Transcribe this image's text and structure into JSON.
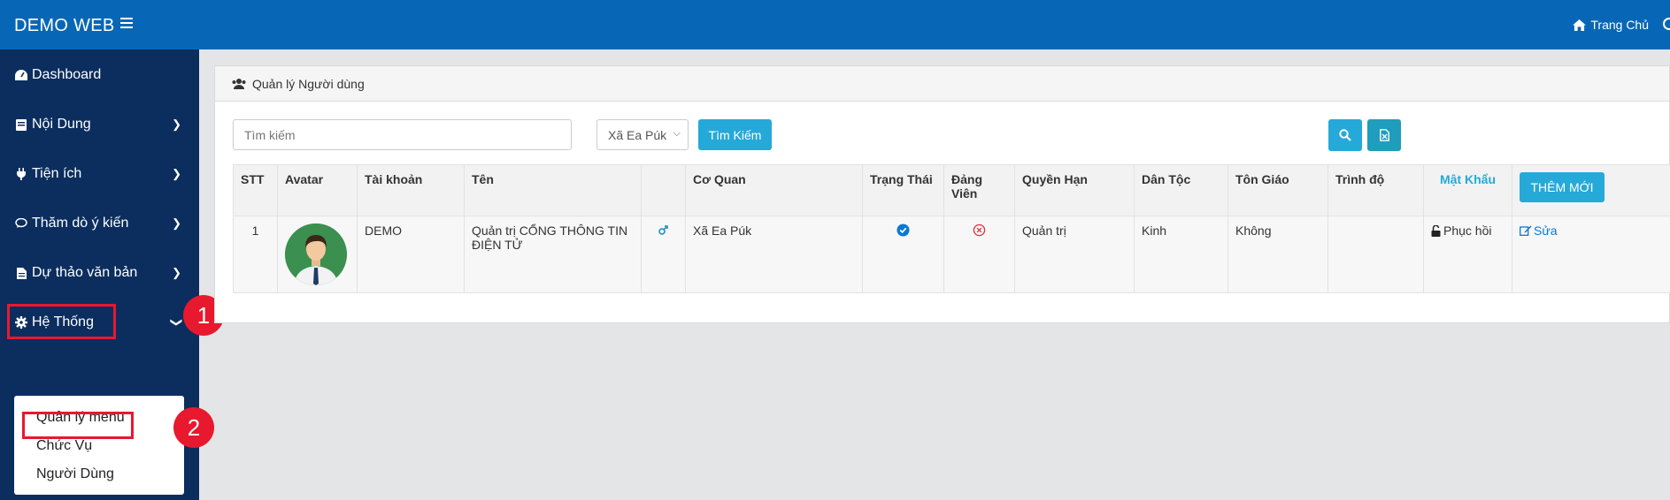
{
  "header": {
    "brand": "DEMO WEB",
    "home_link": "Trang Chủ"
  },
  "sidebar": {
    "items": [
      {
        "label": "Dashboard",
        "icon": "dashboard-icon"
      },
      {
        "label": "Nội Dung",
        "icon": "book-icon"
      },
      {
        "label": "Tiện ích",
        "icon": "plug-icon"
      },
      {
        "label": "Thăm dò ý kiến",
        "icon": "comment-icon"
      },
      {
        "label": "Dự thảo văn bản",
        "icon": "file-icon"
      },
      {
        "label": "Hệ Thống",
        "icon": "gear-icon"
      }
    ],
    "submenu": [
      "Quản lý menu",
      "Chức Vụ",
      "Người Dùng"
    ]
  },
  "annotations": [
    "1",
    "2"
  ],
  "panel": {
    "title": "Quản lý Người dùng",
    "search_placeholder": "Tìm kiếm",
    "select_value": "Xã Ea Púk",
    "search_button": "Tìm Kiếm",
    "add_button": "THÊM MỚI"
  },
  "table": {
    "headers": [
      "STT",
      "Avatar",
      "Tài khoản",
      "Tên",
      "",
      "Cơ Quan",
      "Trạng Thái",
      "Đảng Viên",
      "Quyền Hạn",
      "Dân Tộc",
      "Tôn Giáo",
      "Trình độ",
      "Mật Khẩu"
    ],
    "rows": [
      {
        "stt": "1",
        "account": "DEMO",
        "name": "Quản trị CỔNG THÔNG TIN ĐIỆN TỬ",
        "gender_icon": "male-icon",
        "agency": "Xã Ea Púk",
        "status_icon": "check-circle-icon",
        "party_icon": "x-circle-icon",
        "role": "Quản trị",
        "ethnic": "Kinh",
        "religion": "Không",
        "education": "",
        "password_action": "Phục hồi",
        "edit_action": "Sửa"
      }
    ]
  },
  "colors": {
    "topbar": "#0767b6",
    "sidebar": "#0b2e5e",
    "accent": "#25a9d9",
    "annotation": "#e8182f"
  }
}
